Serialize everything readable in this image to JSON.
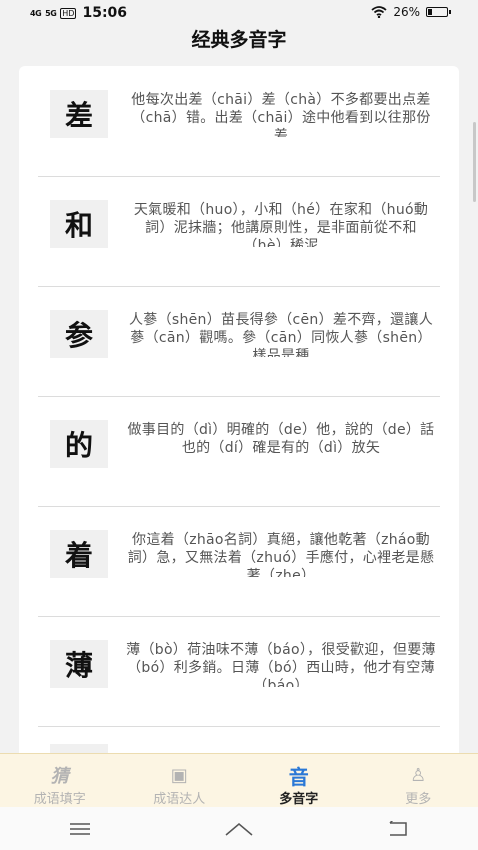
{
  "status": {
    "signal1": "4G",
    "signal2": "5G",
    "hd": "HD",
    "time": "15:06",
    "battery": "26%",
    "battery_level": 0.26
  },
  "page": {
    "title": "经典多音字"
  },
  "items": [
    {
      "char": "差",
      "text": "他每次出差（chāi）差（chà）不多都要出点差（chā）错。出差（chāi）途中他看到以往那份差"
    },
    {
      "char": "和",
      "text": "天氣暖和（huo），小和（hé）在家和（huó動詞）泥抹牆；他講原則性，是非面前從不和（hè）稀泥"
    },
    {
      "char": "参",
      "text": "人蔘（shēn）苗長得參（cēn）差不齊，還讓人蔘（cān）觀嗎。參（cān）同恢人蔘（shēn）樣品是種"
    },
    {
      "char": "的",
      "text": "做事目的（dì）明確的（de）他，說的（de）話也的（dí）確是有的（dì）放矢"
    },
    {
      "char": "着",
      "text": "你這着（zhāo名詞）真絕，讓他乾著（zháo動詞）急，又無法着（zhuó）手應付，心裡老是懸著（zhe）"
    },
    {
      "char": "薄",
      "text": "薄（bò）荷油味不薄（báo），很受歡迎，但要薄（bó）利多銷。日薄（bó）西山時，他才有空薄（báo）"
    }
  ],
  "tabs": [
    {
      "label": "成语填字",
      "icon": "猜"
    },
    {
      "label": "成语达人",
      "icon": "▣"
    },
    {
      "label": "多音字",
      "icon": "音"
    },
    {
      "label": "更多",
      "icon": "♙"
    }
  ]
}
